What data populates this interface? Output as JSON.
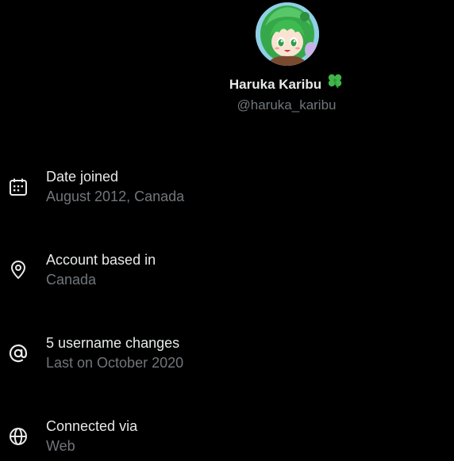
{
  "profile": {
    "display_name": "Haruka Karibu",
    "name_emoji": "clover-emoji",
    "handle": "@haruka_karibu"
  },
  "about": {
    "items": [
      {
        "icon": "calendar-icon",
        "title": "Date joined",
        "value": "August 2012, Canada"
      },
      {
        "icon": "location-pin-icon",
        "title": "Account based in",
        "value": "Canada"
      },
      {
        "icon": "at-sign-icon",
        "title": "5 username changes",
        "value": "Last on October 2020"
      },
      {
        "icon": "globe-icon",
        "title": "Connected via",
        "value": "Web"
      }
    ]
  },
  "colors": {
    "background": "#000000",
    "primary_text": "#e7e9ea",
    "secondary_text": "#71767b",
    "clover": "#3fb54a"
  }
}
